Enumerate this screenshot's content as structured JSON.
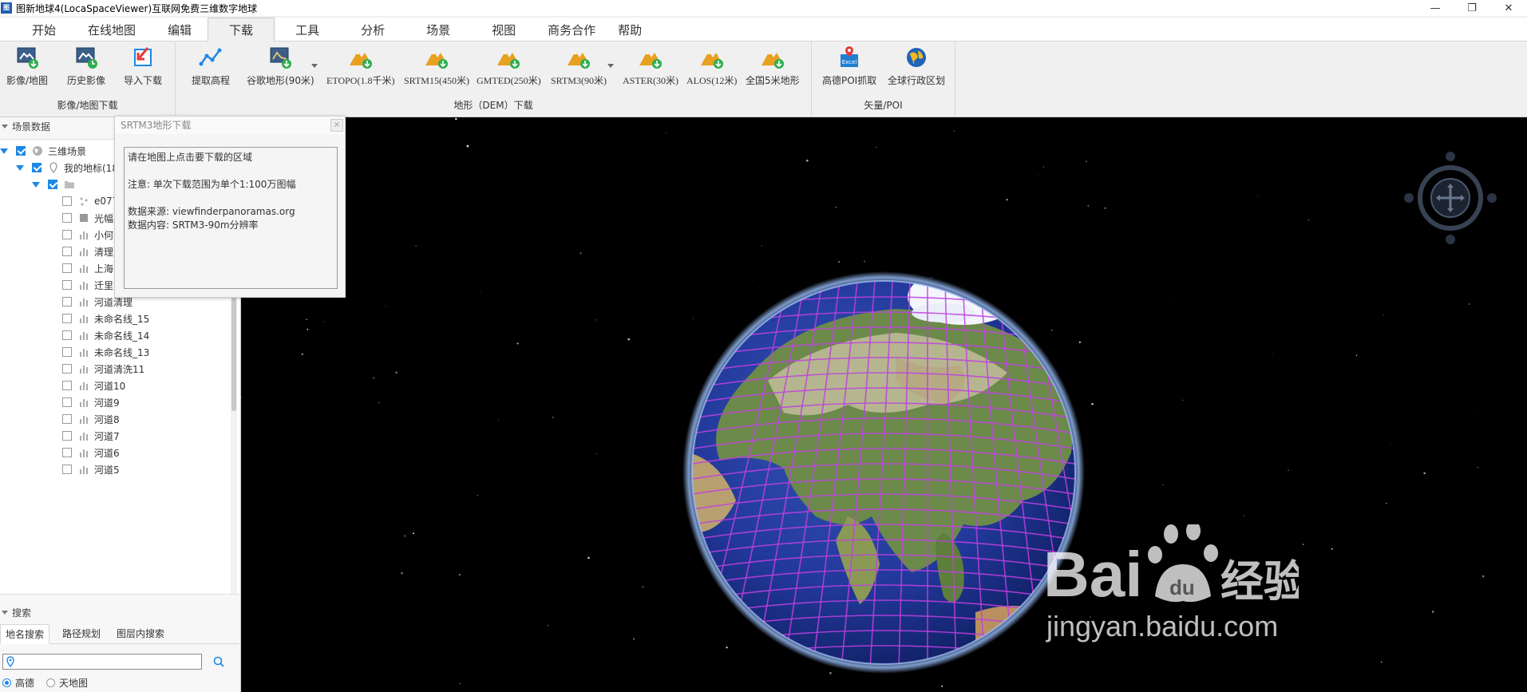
{
  "window": {
    "title": "图新地球4(LocaSpaceViewer)互联网免费三维数字地球",
    "icon_text": "图"
  },
  "menu": {
    "tabs": [
      "开始",
      "在线地图",
      "编辑",
      "下载",
      "工具",
      "分析",
      "场景",
      "视图",
      "商务合作",
      "帮助"
    ],
    "active": "下载"
  },
  "ribbon": {
    "groups": [
      {
        "label": "影像/地图下载",
        "buttons": [
          {
            "label": "影像/地图",
            "icon": "imagery-download-icon"
          },
          {
            "label": "历史影像",
            "icon": "history-imagery-icon"
          },
          {
            "label": "导入下载",
            "icon": "import-download-icon"
          }
        ]
      },
      {
        "label": "地形（DEM）下载",
        "buttons": [
          {
            "label": "提取高程",
            "icon": "elevation-extract-icon"
          },
          {
            "label": "谷歌地形(90米)",
            "icon": "google-terrain-icon"
          },
          {
            "label": "ETOPO(1.8千米)",
            "icon": "terrain-download-icon"
          },
          {
            "label": "SRTM15(450米)",
            "icon": "terrain-download-icon"
          },
          {
            "label": "GMTED(250米)",
            "icon": "terrain-download-icon"
          },
          {
            "label": "SRTM3(90米)",
            "icon": "terrain-download-icon"
          },
          {
            "label": "ASTER(30米)",
            "icon": "terrain-download-icon"
          },
          {
            "label": "ALOS(12米)",
            "icon": "terrain-download-icon"
          },
          {
            "label": "全国5米地形",
            "icon": "terrain-download-icon"
          }
        ]
      },
      {
        "label": "矢量/POI",
        "buttons": [
          {
            "label": "高德POI抓取",
            "icon": "excel-poi-icon",
            "badge": "Excel"
          },
          {
            "label": "全球行政区划",
            "icon": "globe-admin-icon"
          }
        ]
      }
    ]
  },
  "scene_panel": {
    "title": "场景数据",
    "root": "三维场景",
    "marks": "我的地标(18",
    "items": [
      "e077",
      "光幅",
      "小何",
      "清理",
      "上海",
      "迁里",
      "河道清理",
      "未命名线_15",
      "未命名线_14",
      "未命名线_13",
      "河道清洗11",
      "河道10",
      "河道9",
      "河道8",
      "河道7",
      "河道6",
      "河道5"
    ]
  },
  "search_panel": {
    "title": "搜索",
    "tabs": [
      "地名搜索",
      "路径规划",
      "图层内搜索"
    ],
    "active_tab": "地名搜索",
    "input_value": "",
    "providers": [
      "高德",
      "天地图"
    ],
    "selected_provider": "高德"
  },
  "dialog": {
    "title": "SRTM3地形下载",
    "line1": "请在地图上点击要下载的区域",
    "line2": "注意: 单次下载范围为单个1:100万图幅",
    "line3": "数据来源: viewfinderpanoramas.org",
    "line4": "数据内容: SRTM3-90m分辨率"
  },
  "watermark": {
    "brand": "Bai",
    "brand2": "经验",
    "url": "jingyan.baidu.com"
  },
  "colors": {
    "accent": "#1e88e5",
    "grid": "#c040e0",
    "ocean": "#1f3a8a",
    "space": "#000000"
  }
}
